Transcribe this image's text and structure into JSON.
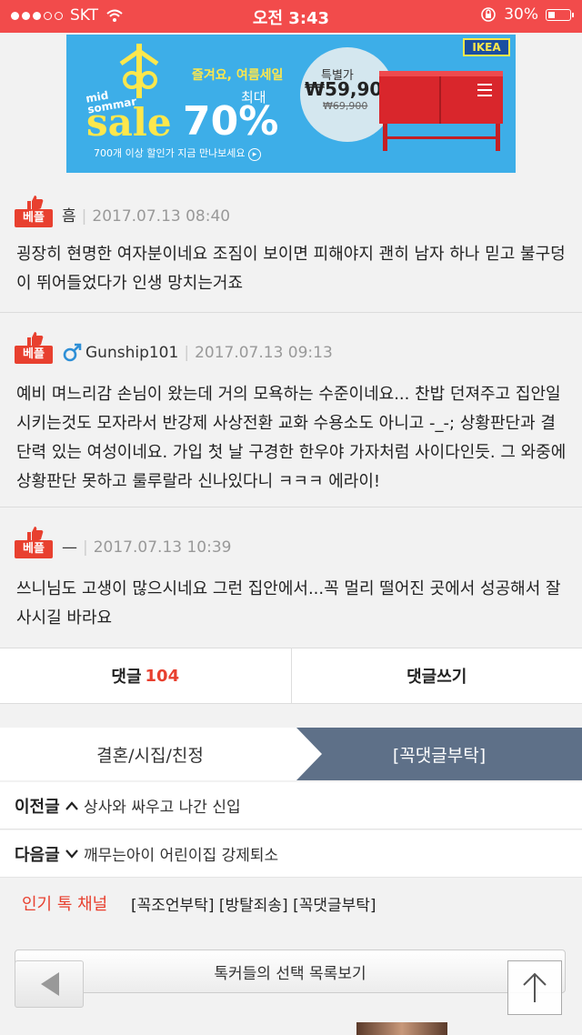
{
  "status_bar": {
    "carrier": "SKT",
    "time": "오전 3:43",
    "battery": "30%",
    "battery_level": 0.3
  },
  "ad": {
    "mid": "mid",
    "sommar": "sommar",
    "sale": "sale",
    "tagline": "즐겨요, 여름세일",
    "max_label": "최대",
    "percent": "70%",
    "footer": "700개 이상 할인가 지금 만나보세요",
    "special_label": "특별가",
    "price": "₩59,900",
    "old_price": "₩69,900",
    "brand": "IKEA"
  },
  "comments": [
    {
      "badge": "베플",
      "author": "흠",
      "date": "2017.07.13 08:40",
      "text": "굉장히 현명한 여자분이네요 조짐이 보이면 피해야지 괜히 남자 하나 믿고 불구덩이 뛰어들었다가 인생 망치는거죠"
    },
    {
      "badge": "베플",
      "author": "Gunship101",
      "date": "2017.07.13 09:13",
      "text": "예비 며느리감 손님이 왔는데 거의 모욕하는 수준이네요... 찬밥 던져주고 집안일 시키는것도 모자라서 반강제 사상전환 교화 수용소도 아니고 -_-; 상황판단과 결단력 있는 여성이네요. 가입 첫 날 구경한 한우야 가자처럼 사이다인듯. 그 와중에 상황판단 못하고 룰루랄라 신나있다니 ㅋㅋㅋ 에라이!"
    },
    {
      "badge": "베플",
      "author": "—",
      "date": "2017.07.13 10:39",
      "text": "쓰니님도 고생이 많으시네요 그런 집안에서...꼭 멀리 떨어진 곳에서 성공해서 잘 사시길 바라요"
    }
  ],
  "reply_bar": {
    "comments_label": "댓글",
    "comments_count": "104",
    "write_label": "댓글쓰기"
  },
  "category": {
    "left": "결혼/시집/친정",
    "right": "[꼭댓글부탁]"
  },
  "prev": {
    "label": "이전글",
    "title": "상사와 싸우고 나간 신입"
  },
  "next": {
    "label": "다음글",
    "title": "깨무는아이 어린이집 강제퇴소"
  },
  "hot": {
    "label": "인기 톡 채널",
    "items": "[꼭조언부탁] [방탈죄송] [꼭댓글부탁]"
  },
  "list_button": "톡커들의 선택 목록보기",
  "colors": {
    "status_red": "#f24b4b",
    "accent_red": "#e8402f",
    "category_blue": "#5e7088"
  }
}
